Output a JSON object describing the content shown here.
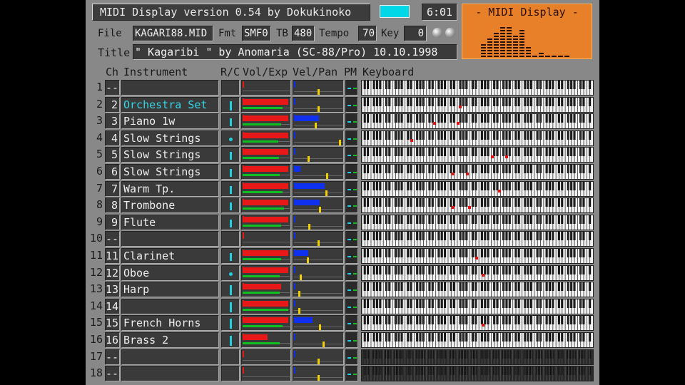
{
  "header": {
    "app_title": "MIDI Display  version 0.54  by Dokukinoko",
    "time": "6:01",
    "color_accent": "#00d8e8"
  },
  "file_row": {
    "file_label": "File",
    "file_value": "KAGARI88.MID",
    "fmt_label": "Fmt",
    "fmt_value": "SMF0",
    "tb_label": "TB",
    "tb_value": "480",
    "tempo_label": "Tempo",
    "tempo_value": "70",
    "key_label": "Key",
    "key_value": "0"
  },
  "title_row": {
    "title_label": "Title",
    "title_value": "\" Kagaribi \" by Anomaria (SC-88/Pro) 10.10.1998"
  },
  "logo_panel": {
    "title": "- MIDI Display -",
    "bar_levels": [
      0.45,
      0.55,
      0.75,
      0.95,
      0.9,
      0.7,
      0.85,
      0.35,
      0.12,
      0.18,
      0.06,
      0.05,
      0.08,
      0.06
    ]
  },
  "columns": {
    "ch": "Ch",
    "instrument": "Instrument",
    "rc": "R/C",
    "volexp": "Vol/Exp",
    "velpan": "Vel/Pan",
    "pm": "PM",
    "keyboard": "Keyboard"
  },
  "channels": [
    {
      "row": "1",
      "num": "--",
      "name": "",
      "rc": 0,
      "vol": 0,
      "exp": 0,
      "vel": 0,
      "pan": 0.52,
      "notes": []
    },
    {
      "row": "2",
      "num": "2",
      "name": "Orchestra Set",
      "rc": 0.7,
      "vol": 1.0,
      "exp": 0.88,
      "vel": 0,
      "pan": 0.52,
      "notes": [
        0.42
      ],
      "highlight": true
    },
    {
      "row": "3",
      "num": "3",
      "name": "Piano 1w",
      "rc": 0.6,
      "vol": 1.0,
      "exp": 0.85,
      "vel": 0.52,
      "pan": 0.45,
      "notes": [
        0.31,
        0.41
      ]
    },
    {
      "row": "4",
      "num": "4",
      "name": "Slow Strings",
      "rc": 0.3,
      "vol": 1.0,
      "exp": 0.78,
      "vel": 0,
      "pan": 0.98,
      "notes": [
        0.21
      ]
    },
    {
      "row": "5",
      "num": "5",
      "name": "Slow Strings",
      "rc": 0.6,
      "vol": 1.0,
      "exp": 0.8,
      "vel": 0,
      "pan": 0.3,
      "notes": [
        0.56,
        0.62
      ]
    },
    {
      "row": "6",
      "num": "6",
      "name": "Slow Strings",
      "rc": 0.6,
      "vol": 1.0,
      "exp": 0.82,
      "vel": 0.13,
      "pan": 0.7,
      "notes": [
        0.39,
        0.45
      ]
    },
    {
      "row": "7",
      "num": "7",
      "name": "Warm Tp.",
      "rc": 0.6,
      "vol": 1.0,
      "exp": 0.88,
      "vel": 0.63,
      "pan": 0.68,
      "notes": [
        0.59
      ]
    },
    {
      "row": "8",
      "num": "8",
      "name": "Trombone",
      "rc": 0.6,
      "vol": 1.0,
      "exp": 0.9,
      "vel": 0.53,
      "pan": 0.55,
      "notes": [
        0.39,
        0.46
      ]
    },
    {
      "row": "9",
      "num": "9",
      "name": "Flute",
      "rc": 0.6,
      "vol": 1.0,
      "exp": 0.85,
      "vel": 0,
      "pan": 0.32,
      "notes": []
    },
    {
      "row": "10",
      "num": "--",
      "name": "",
      "rc": 0,
      "vol": 0,
      "exp": 0,
      "vel": 0,
      "pan": 0.52,
      "notes": []
    },
    {
      "row": "11",
      "num": "11",
      "name": "Clarinet",
      "rc": 0.6,
      "vol": 1.0,
      "exp": 0.85,
      "vel": 0.3,
      "pan": 0.28,
      "notes": [
        0.49
      ]
    },
    {
      "row": "12",
      "num": "12",
      "name": "Oboe",
      "rc": 0.25,
      "vol": 1.0,
      "exp": 0.82,
      "vel": 0,
      "pan": 0.12,
      "notes": [
        0.52
      ]
    },
    {
      "row": "13",
      "num": "13",
      "name": "Harp",
      "rc": 0.75,
      "vol": 0.85,
      "exp": 0.82,
      "vel": 0,
      "pan": 0.1,
      "notes": []
    },
    {
      "row": "14",
      "num": "14",
      "name": "",
      "rc": 0.75,
      "vol": 1.0,
      "exp": 1.0,
      "vel": 0,
      "pan": 0.1,
      "notes": []
    },
    {
      "row": "15",
      "num": "15",
      "name": "French Horns",
      "rc": 0.75,
      "vol": 1.0,
      "exp": 0.88,
      "vel": 0.38,
      "pan": 0.55,
      "notes": [
        0.52
      ]
    },
    {
      "row": "16",
      "num": "16",
      "name": "Brass 2",
      "rc": 0.75,
      "vol": 0.55,
      "exp": 0.82,
      "vel": 0,
      "pan": 0.62,
      "notes": []
    },
    {
      "row": "17",
      "num": "--",
      "name": "",
      "rc": 0,
      "vol": 0,
      "exp": 0,
      "vel": 0,
      "pan": 0.52,
      "notes": [],
      "dim": true
    },
    {
      "row": "18",
      "num": "--",
      "name": "",
      "rc": 0,
      "vol": 0,
      "exp": 0,
      "vel": 0,
      "pan": 0.52,
      "notes": [],
      "dim": true
    }
  ],
  "colors": {
    "vol": "#e81818",
    "exp": "#10c020",
    "vel": "#1030f0",
    "pan": "#f0d000",
    "rc": "#20d0e0",
    "note": "#e01010",
    "highlight_text": "#30d8e8"
  }
}
